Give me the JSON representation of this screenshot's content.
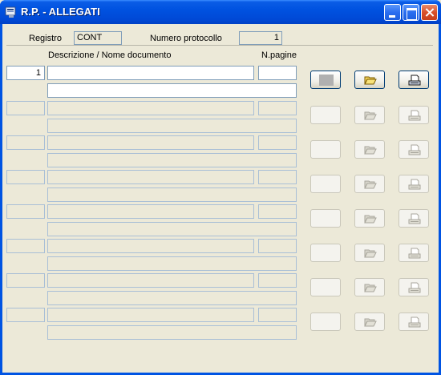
{
  "window": {
    "title": "R.P. - ALLEGATI",
    "icons": [
      "app-icon",
      "minimize-icon",
      "maximize-icon",
      "close-icon"
    ]
  },
  "header": {
    "registro_label": "Registro",
    "registro_value": "CONT",
    "protocollo_label": "Numero protocollo",
    "protocollo_value": "1"
  },
  "columns": {
    "descrizione": "Descrizione / Nome documento",
    "npagine": "N.pagine"
  },
  "rows": [
    {
      "number": "1",
      "descrizione": "",
      "descrizione2": "",
      "npagine": ""
    },
    {
      "number": "",
      "descrizione": "",
      "descrizione2": "",
      "npagine": ""
    },
    {
      "number": "",
      "descrizione": "",
      "descrizione2": "",
      "npagine": ""
    },
    {
      "number": "",
      "descrizione": "",
      "descrizione2": "",
      "npagine": ""
    },
    {
      "number": "",
      "descrizione": "",
      "descrizione2": "",
      "npagine": ""
    },
    {
      "number": "",
      "descrizione": "",
      "descrizione2": "",
      "npagine": ""
    },
    {
      "number": "",
      "descrizione": "",
      "descrizione2": "",
      "npagine": ""
    },
    {
      "number": "",
      "descrizione": "",
      "descrizione2": "",
      "npagine": ""
    }
  ],
  "row_buttons": [
    "square-button",
    "open-folder-button",
    "print-document-button"
  ]
}
